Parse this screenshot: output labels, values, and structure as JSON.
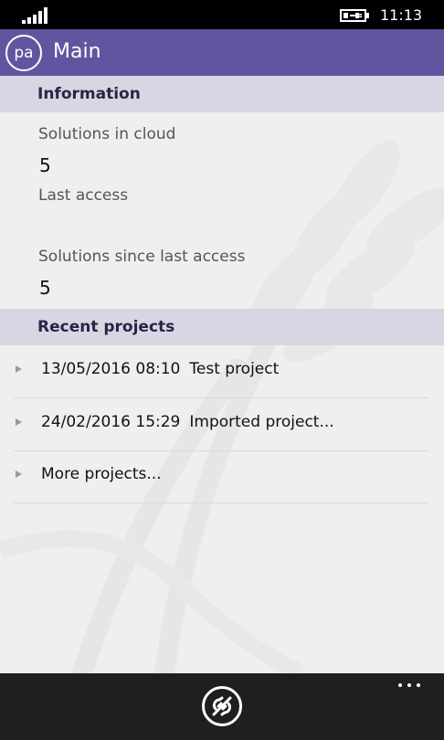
{
  "status_bar": {
    "time": "11:13",
    "signal_icon": "signal-strength-icon",
    "battery_icon": "battery-charging-icon"
  },
  "header": {
    "logo_text": "pa",
    "title": "Main",
    "background_color": "#62549f"
  },
  "information": {
    "heading": "Information",
    "fields": [
      {
        "label": "Solutions in cloud",
        "value": "5"
      },
      {
        "label": "Last access",
        "value": ""
      },
      {
        "label": "Solutions since last access",
        "value": "5"
      }
    ]
  },
  "recent_projects": {
    "heading": "Recent projects",
    "items": [
      {
        "date": "13/05/2016 08:10",
        "name": "Test project"
      },
      {
        "date": "24/02/2016 15:29",
        "name": "Imported project..."
      },
      {
        "date": "",
        "name": "More projects..."
      }
    ]
  },
  "app_bar": {
    "button_icon": "disconnect-plug-icon",
    "more_icon": "more-dots-icon"
  }
}
